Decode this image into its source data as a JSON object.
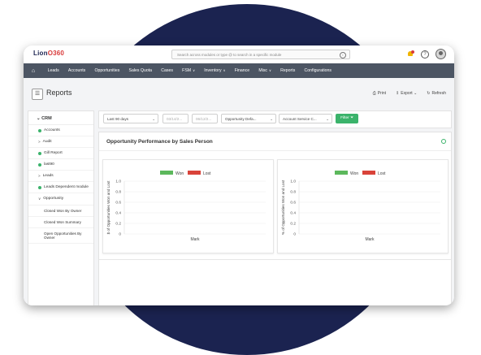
{
  "app": {
    "logo_prefix": "Lion",
    "logo_suffix": "O360"
  },
  "search": {
    "placeholder": "Search across modules or type @ to search in a specific module"
  },
  "nav": {
    "items": [
      {
        "label": "Leads",
        "dropdown": false
      },
      {
        "label": "Accounts",
        "dropdown": false
      },
      {
        "label": "Opportunities",
        "dropdown": false
      },
      {
        "label": "Sales Quota",
        "dropdown": false
      },
      {
        "label": "Cases",
        "dropdown": false
      },
      {
        "label": "FSM",
        "dropdown": true
      },
      {
        "label": "Inventory",
        "dropdown": true
      },
      {
        "label": "Finance",
        "dropdown": false
      },
      {
        "label": "Misc",
        "dropdown": true
      },
      {
        "label": "Reports",
        "dropdown": false
      },
      {
        "label": "Configurations",
        "dropdown": false
      }
    ]
  },
  "header": {
    "title": "Reports",
    "print": "Print",
    "export": "Export",
    "refresh": "Refresh"
  },
  "sidebar": {
    "section": "CRM",
    "items": [
      {
        "label": "Accounts",
        "kind": "dot"
      },
      {
        "label": "Audit",
        "kind": "arrow"
      },
      {
        "label": "Gill Report",
        "kind": "dot"
      },
      {
        "label": "last90",
        "kind": "dot"
      },
      {
        "label": "Leads",
        "kind": "arrow"
      },
      {
        "label": "Leads Dependent module",
        "kind": "dot"
      },
      {
        "label": "Opportunity",
        "kind": "open"
      }
    ],
    "subitems": [
      "Closed Won By Owner",
      "Closed Won Summary",
      "Open Opportunities By Owner"
    ]
  },
  "filters": {
    "range": "Last 90 days",
    "date_from": "03/14/2...",
    "date_to": "06/12/2...",
    "opportunity": "Opportunity Defa...",
    "account": "Account Service C...",
    "filter_button": "Filter"
  },
  "panel": {
    "title": "Opportunity Performance by Sales Person"
  },
  "colors": {
    "won": "#5cb85c",
    "lost": "#d9433a",
    "accent": "#3bb36b",
    "nav": "#4c5563"
  },
  "chart_data": [
    {
      "type": "bar",
      "categories": [
        "Mark"
      ],
      "series": [
        {
          "name": "Won",
          "values": []
        },
        {
          "name": "Lost",
          "values": []
        }
      ],
      "ylabel": "$ of Opportunities Won and Lost",
      "xlabel": "",
      "ylim": [
        0,
        1.0
      ],
      "yticks": [
        "1.0",
        "0.8",
        "0.6",
        "0.4",
        "0.2",
        "0"
      ],
      "legend": "top-center",
      "grid": true
    },
    {
      "type": "bar",
      "categories": [
        "Mark"
      ],
      "series": [
        {
          "name": "Won",
          "values": []
        },
        {
          "name": "Lost",
          "values": []
        }
      ],
      "ylabel": "% of Opportunities Won and Lost",
      "xlabel": "",
      "ylim": [
        0,
        1.0
      ],
      "yticks": [
        "1.0",
        "0.8",
        "0.6",
        "0.4",
        "0.2",
        "0"
      ],
      "legend": "top-center",
      "grid": true
    }
  ]
}
